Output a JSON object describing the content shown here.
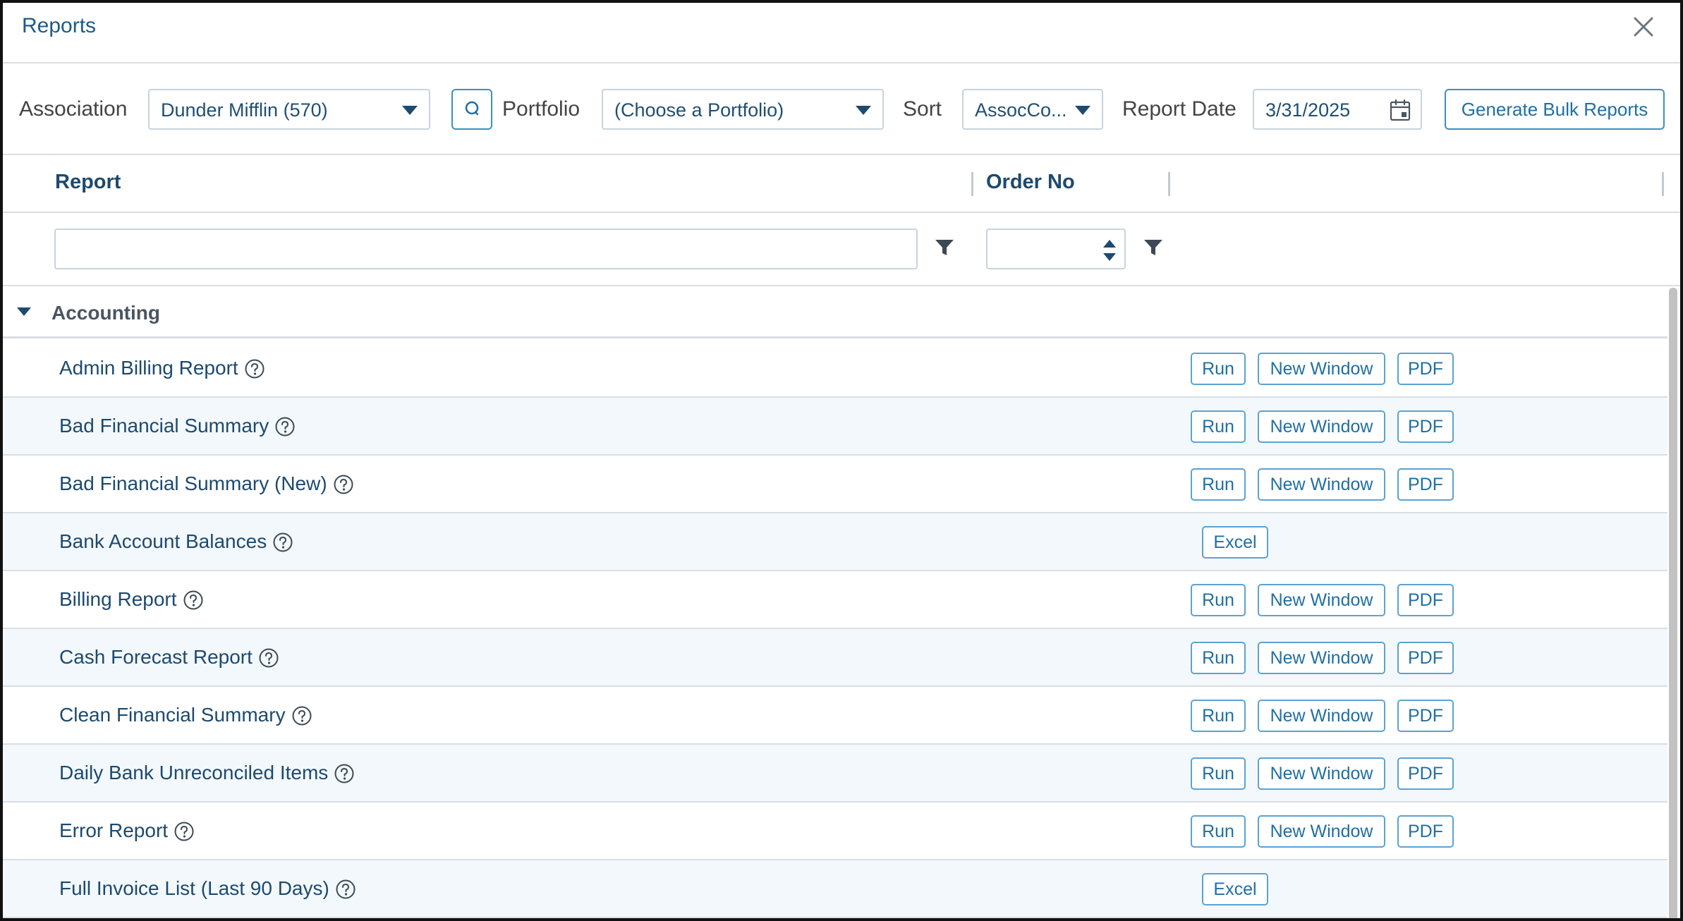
{
  "dialog": {
    "title": "Reports"
  },
  "toolbar": {
    "association_label": "Association",
    "association_value": "Dunder Mifflin (570)",
    "portfolio_label": "Portfolio",
    "portfolio_value": "(Choose a Portfolio)",
    "sort_label": "Sort",
    "sort_value": "AssocCo...",
    "report_date_label": "Report Date",
    "report_date_value": "3/31/2025",
    "bulk_button": "Generate Bulk Reports"
  },
  "grid": {
    "col_report": "Report",
    "col_order": "Order No"
  },
  "group": {
    "label": "Accounting"
  },
  "rows": [
    {
      "name": "Admin Billing Report",
      "kind": "std"
    },
    {
      "name": "Bad Financial Summary",
      "kind": "std"
    },
    {
      "name": "Bad Financial Summary (New)",
      "kind": "std"
    },
    {
      "name": "Bank Account Balances",
      "kind": "excel"
    },
    {
      "name": "Billing Report",
      "kind": "std"
    },
    {
      "name": "Cash Forecast Report",
      "kind": "std"
    },
    {
      "name": "Clean Financial Summary",
      "kind": "std"
    },
    {
      "name": "Daily Bank Unreconciled Items",
      "kind": "std"
    },
    {
      "name": "Error Report",
      "kind": "std"
    },
    {
      "name": "Full Invoice List (Last 90 Days)",
      "kind": "excel"
    }
  ],
  "buttons": {
    "run": "Run",
    "new_window": "New Window",
    "pdf": "PDF",
    "excel": "Excel"
  },
  "colors": {
    "accent": "#1f6fa3",
    "text": "#1d4a6e",
    "alt_row": "#f3f8fc",
    "border": "#d9dee3"
  }
}
